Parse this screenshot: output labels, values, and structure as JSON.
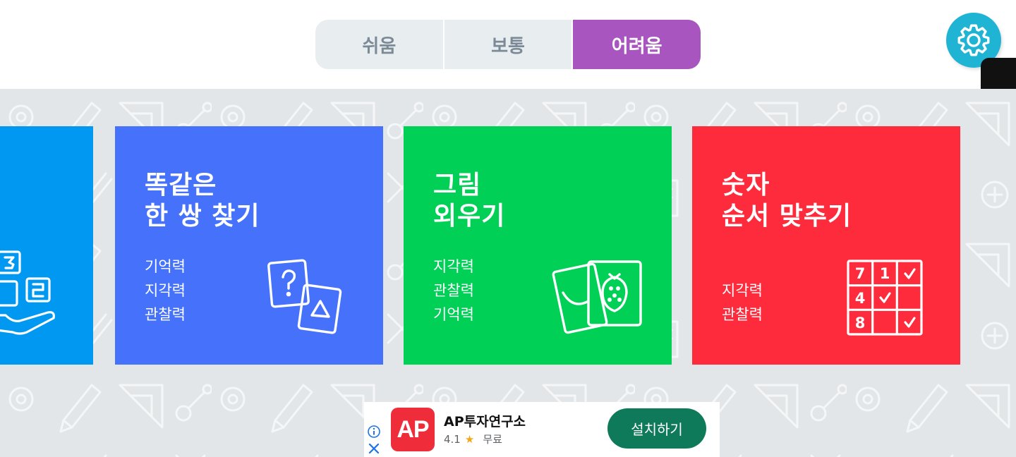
{
  "difficulty": {
    "options": [
      {
        "label": "쉬움",
        "active": false
      },
      {
        "label": "보통",
        "active": false
      },
      {
        "label": "어려움",
        "active": true
      }
    ]
  },
  "settings": {
    "icon": "gear-icon",
    "color": "#20b4d4"
  },
  "games": [
    {
      "title_line1": "",
      "title_line2": "",
      "skills": [],
      "color": "#0098f0",
      "icon": "number-blocks-hand-icon",
      "partial": true
    },
    {
      "title_line1": "똑같은",
      "title_line2": "한 쌍 찾기",
      "skills": [
        "기억력",
        "지각력",
        "관찰력"
      ],
      "color": "#4571fb",
      "icon": "question-cards-icon"
    },
    {
      "title_line1": "그림",
      "title_line2": "외우기",
      "skills": [
        "지각력",
        "관찰력",
        "기억력"
      ],
      "color": "#00d056",
      "icon": "fruit-cards-icon"
    },
    {
      "title_line1": "숫자",
      "title_line2": "순서 맞추기",
      "skills": [
        "지각력",
        "관찰력"
      ],
      "color": "#fd2b3b",
      "icon": "number-grid-icon"
    }
  ],
  "ad": {
    "logo_text": "AP",
    "app_name": "AP투자연구소",
    "rating": "4.1",
    "price": "무료",
    "install_label": "설치하기"
  }
}
